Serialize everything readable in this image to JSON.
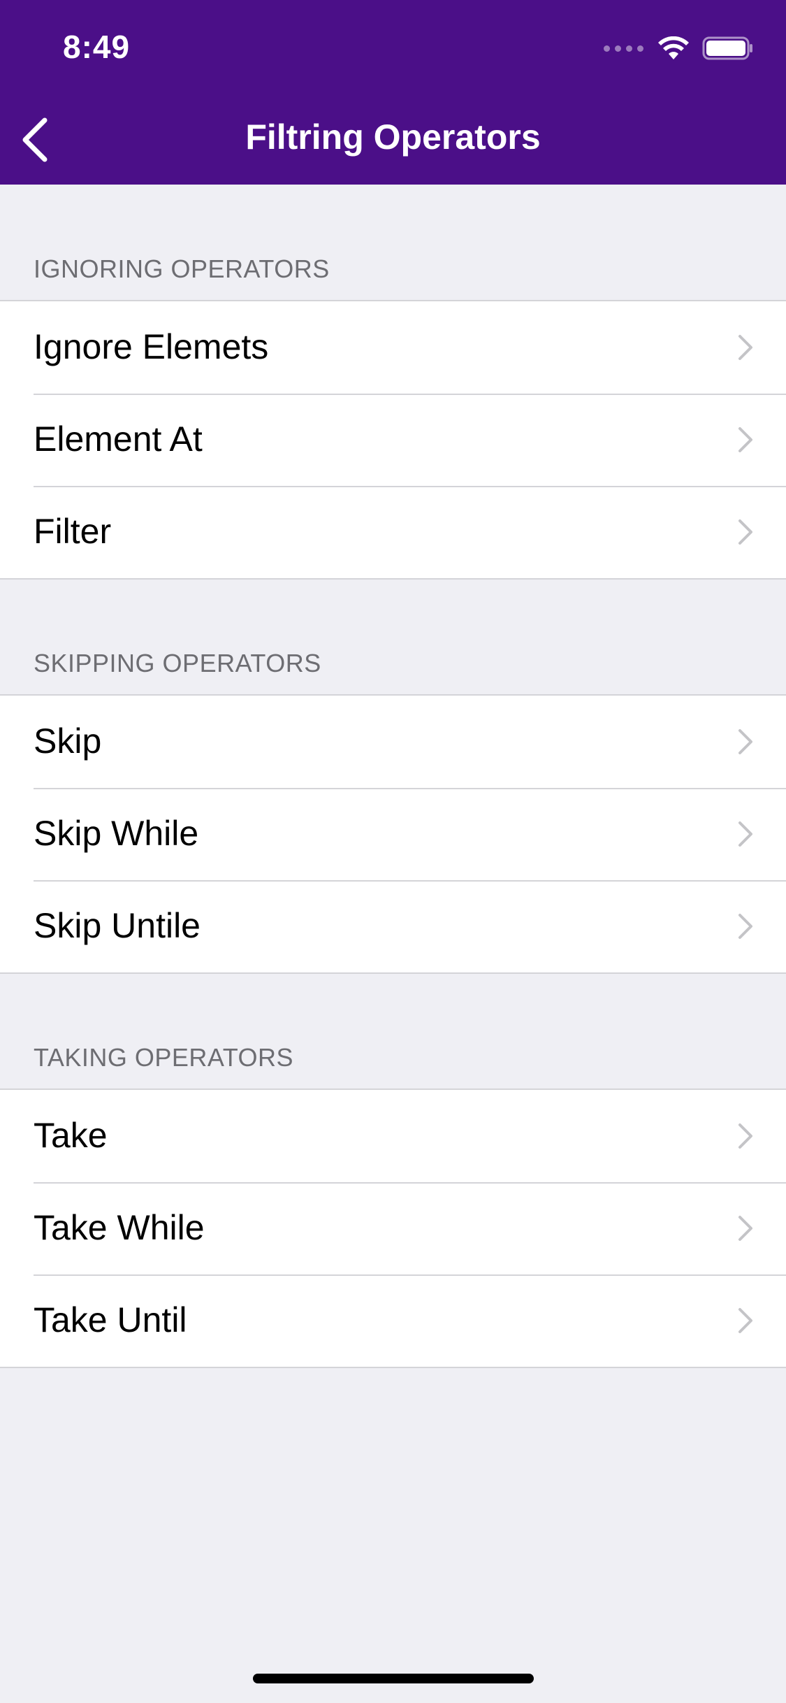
{
  "status_bar": {
    "time": "8:49",
    "icons": [
      "cellular-signal-icon",
      "wifi-icon",
      "battery-icon"
    ]
  },
  "nav": {
    "title": "Filtring Operators",
    "back_icon": "chevron-left-icon",
    "background_color": "#4b0f88"
  },
  "sections": [
    {
      "header": "IGNORING OPERATORS",
      "items": [
        {
          "label": "Ignore Elemets"
        },
        {
          "label": "Element At"
        },
        {
          "label": "Filter"
        }
      ]
    },
    {
      "header": "SKIPPING OPERATORS",
      "items": [
        {
          "label": "Skip"
        },
        {
          "label": "Skip While"
        },
        {
          "label": "Skip Untile"
        }
      ]
    },
    {
      "header": "TAKING OPERATORS",
      "items": [
        {
          "label": "Take"
        },
        {
          "label": "Take While"
        },
        {
          "label": "Take Until"
        }
      ]
    }
  ],
  "row_accessory_icon": "chevron-right-icon"
}
